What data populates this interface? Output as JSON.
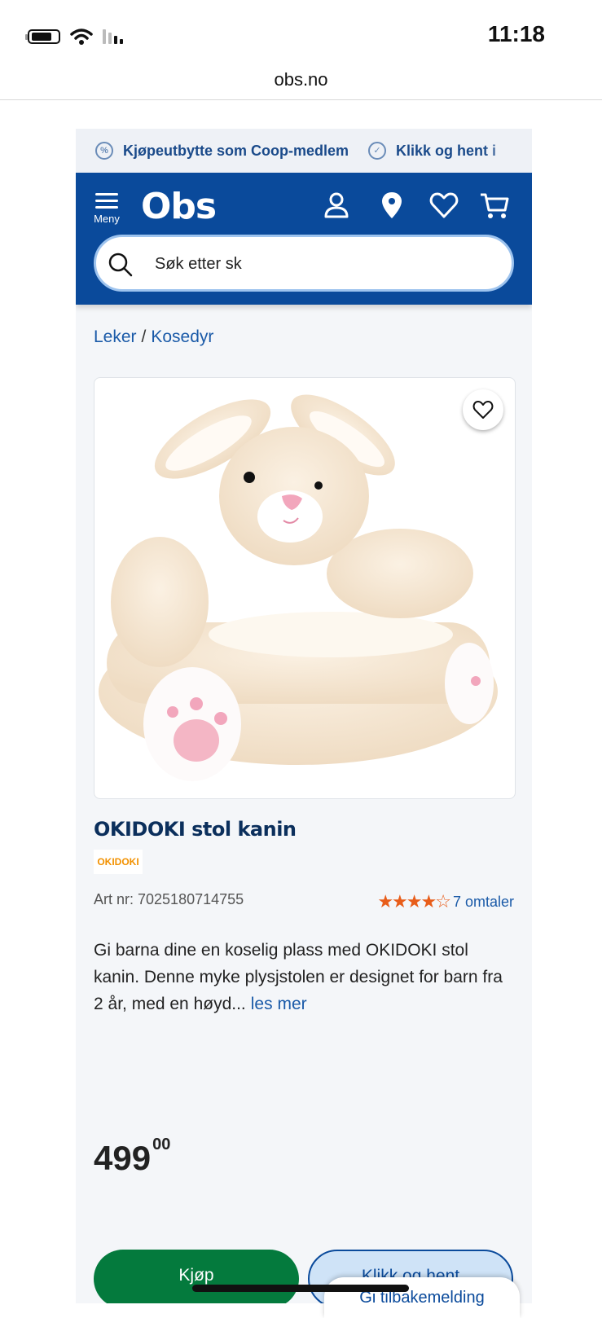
{
  "status_bar": {
    "time": "11:18"
  },
  "browser": {
    "url": "obs.no"
  },
  "usp_bar": {
    "items": [
      {
        "icon": "percent-icon",
        "label": "Kjøpeutbytte som Coop-medlem"
      },
      {
        "icon": "check-circle-icon",
        "label": "Klikk og hent i"
      }
    ]
  },
  "header": {
    "menu_label": "Meny",
    "logo_text": "Obs",
    "search_placeholder": "Søk etter sk",
    "brand_color": "#0a4a9b"
  },
  "breadcrumb": {
    "items": [
      "Leker",
      "Kosedyr"
    ],
    "separator": "/"
  },
  "product": {
    "title": "OKIDOKI stol kanin",
    "brand": "OKIDOKI",
    "art_nr": "Art nr: 7025180714755",
    "rating": 4.5,
    "stars": "★★★★☆",
    "reviews": "7 omtaler",
    "description": "Gi barna dine en koselig plass med OKIDOKI stol kanin. Denne myke plysjstolen er designet for barn fra 2 år, med en høyd...",
    "read_more": "les mer",
    "price_main": "499",
    "price_decimals": "00"
  },
  "actions": {
    "buy": "Kjøp",
    "click_collect": "Klikk og hent",
    "feedback": "Gi tilbakemelding"
  }
}
